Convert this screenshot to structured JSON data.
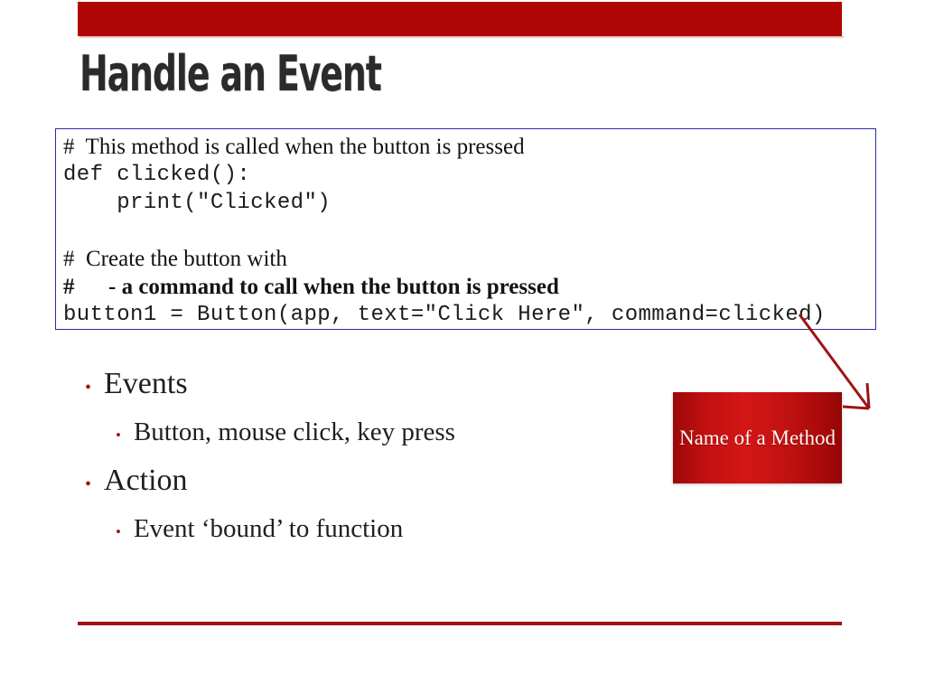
{
  "slide": {
    "title": "Handle an Event",
    "banner_color": "#b00505",
    "rule_color": "#9e1313"
  },
  "code_box": {
    "border_color": "#2b2baa",
    "lines": [
      {
        "style": "comment",
        "text": "#  This method is called when the button is pressed"
      },
      {
        "style": "mono",
        "text": "def clicked():"
      },
      {
        "style": "mono",
        "text": "    print(\"Clicked\")"
      },
      {
        "style": "blank",
        "text": ""
      },
      {
        "style": "comment",
        "text": "#  Create the button with"
      },
      {
        "style": "comment-bold",
        "text": "#      - a command to call when the button is pressed"
      },
      {
        "style": "mono",
        "text": "button1 = Button(app, text=\"Click Here\", command=clicked)"
      }
    ]
  },
  "bullets": [
    {
      "level": 1,
      "marker": "•",
      "text": "Events"
    },
    {
      "level": 2,
      "marker": "•",
      "text": "Button, mouse click, key press"
    },
    {
      "level": 1,
      "marker": "•",
      "text": "Action"
    },
    {
      "level": 2,
      "marker": "•",
      "text": "Event ‘bound’ to function"
    }
  ],
  "callout": {
    "text": "Name of a Method",
    "fill_color": "#c01010",
    "text_color": "#fdf6f4",
    "arrow_color": "#9e1313"
  }
}
